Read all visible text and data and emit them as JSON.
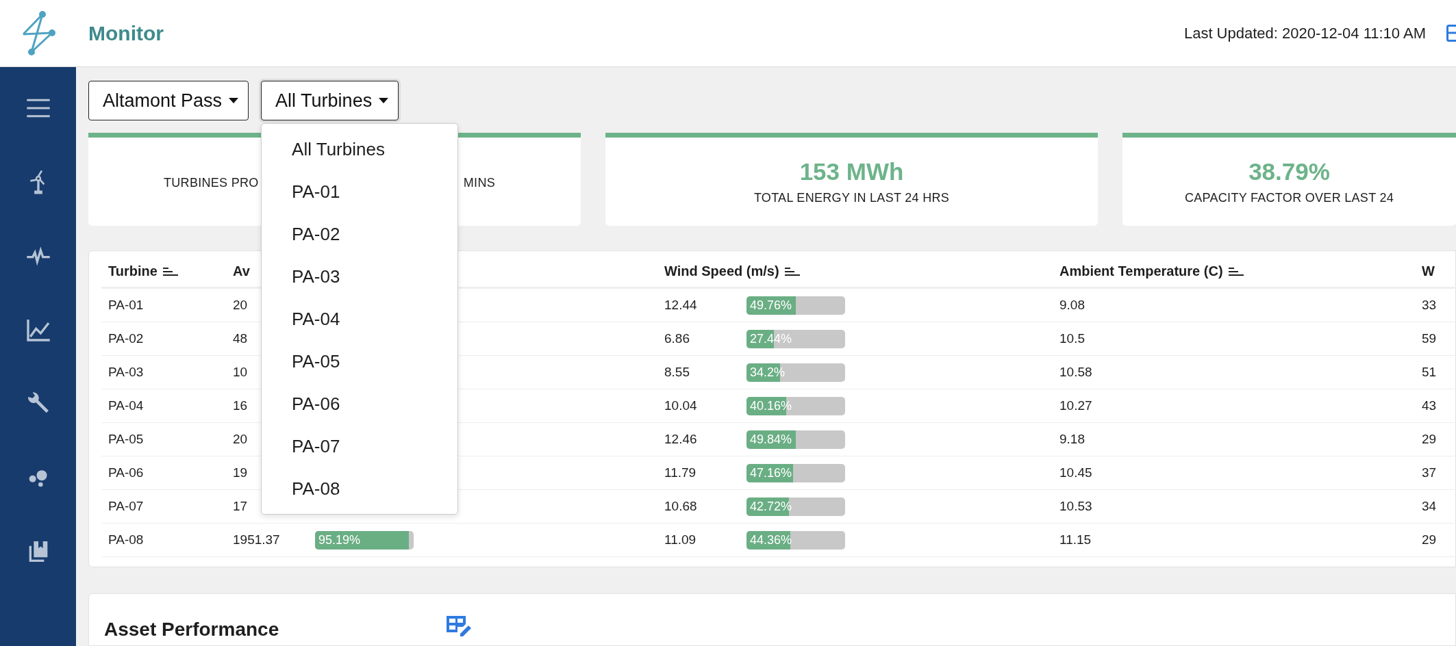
{
  "header": {
    "title": "Monitor",
    "last_updated": "Last Updated: 2020-12-04 11:10 AM"
  },
  "filters": [
    {
      "label": "Altamont Pass",
      "expanded": false
    },
    {
      "label": "All Turbines",
      "expanded": true
    }
  ],
  "dropdown": {
    "items": [
      "All Turbines",
      "PA-01",
      "PA-02",
      "PA-03",
      "PA-04",
      "PA-05",
      "PA-06",
      "PA-07",
      "PA-08"
    ]
  },
  "kpi_cards": [
    {
      "label_parts": [
        "TURBINES PRO",
        "MINS"
      ]
    },
    {
      "value": "153 MWh",
      "label_parts": [
        "TOTAL ENERGY IN LAST 24 HRS"
      ]
    },
    {
      "value": "38.79%",
      "label_parts": [
        "CAPACITY FACTOR OVER LAST 24"
      ]
    }
  ],
  "table": {
    "columns": [
      {
        "label": "Turbine",
        "sort_icon": true
      },
      {
        "label": "Av",
        "sort_icon": false
      },
      {
        "label": "Wind Speed (m/s)",
        "sort_icon": true
      },
      {
        "label": "Ambient Temperature (C)",
        "sort_icon": true
      },
      {
        "label": "W",
        "sort_icon": false
      }
    ],
    "rows": [
      {
        "turbine": "PA-01",
        "column_2": {
          "value": "20"
        },
        "wind": {
          "value": "12.44",
          "bar": {
            "level": 0.4976,
            "label": "49.76%"
          }
        },
        "temp": "9.08",
        "column_5": "33"
      },
      {
        "turbine": "PA-02",
        "column_2": {
          "value": "48"
        },
        "wind": {
          "value": "6.86",
          "bar": {
            "level": 0.2744,
            "label": "27.44%"
          }
        },
        "temp": "10.5",
        "column_5": "59"
      },
      {
        "turbine": "PA-03",
        "column_2": {
          "value": "10"
        },
        "wind": {
          "value": "8.55",
          "bar": {
            "level": 0.342,
            "label": "34.2%"
          }
        },
        "temp": "10.58",
        "column_5": "51"
      },
      {
        "turbine": "PA-04",
        "column_2": {
          "value": "16"
        },
        "wind": {
          "value": "10.04",
          "bar": {
            "level": 0.4016,
            "label": "40.16%"
          }
        },
        "temp": "10.27",
        "column_5": "43"
      },
      {
        "turbine": "PA-05",
        "column_2": {
          "value": "20"
        },
        "wind": {
          "value": "12.46",
          "bar": {
            "level": 0.4984,
            "label": "49.84%"
          }
        },
        "temp": "9.18",
        "column_5": "29"
      },
      {
        "turbine": "PA-06",
        "column_2": {
          "value": "19"
        },
        "wind": {
          "value": "11.79",
          "bar": {
            "level": 0.4716,
            "label": "47.16%"
          }
        },
        "temp": "10.45",
        "column_5": "37"
      },
      {
        "turbine": "PA-07",
        "column_2": {
          "value": "17"
        },
        "wind": {
          "value": "10.68",
          "bar": {
            "level": 0.4272,
            "label": "42.72%"
          }
        },
        "temp": "10.53",
        "column_5": "34"
      },
      {
        "turbine": "PA-08",
        "column_2": {
          "value": "1951.37",
          "bar": {
            "level": 0.9519,
            "label": "95.19%"
          }
        },
        "wind": {
          "value": "11.09",
          "bar": {
            "level": 0.4436,
            "label": "44.36%"
          }
        },
        "temp": "11.15",
        "column_5": "29"
      }
    ]
  },
  "asset_performance": {
    "title": "Asset Performance"
  }
}
